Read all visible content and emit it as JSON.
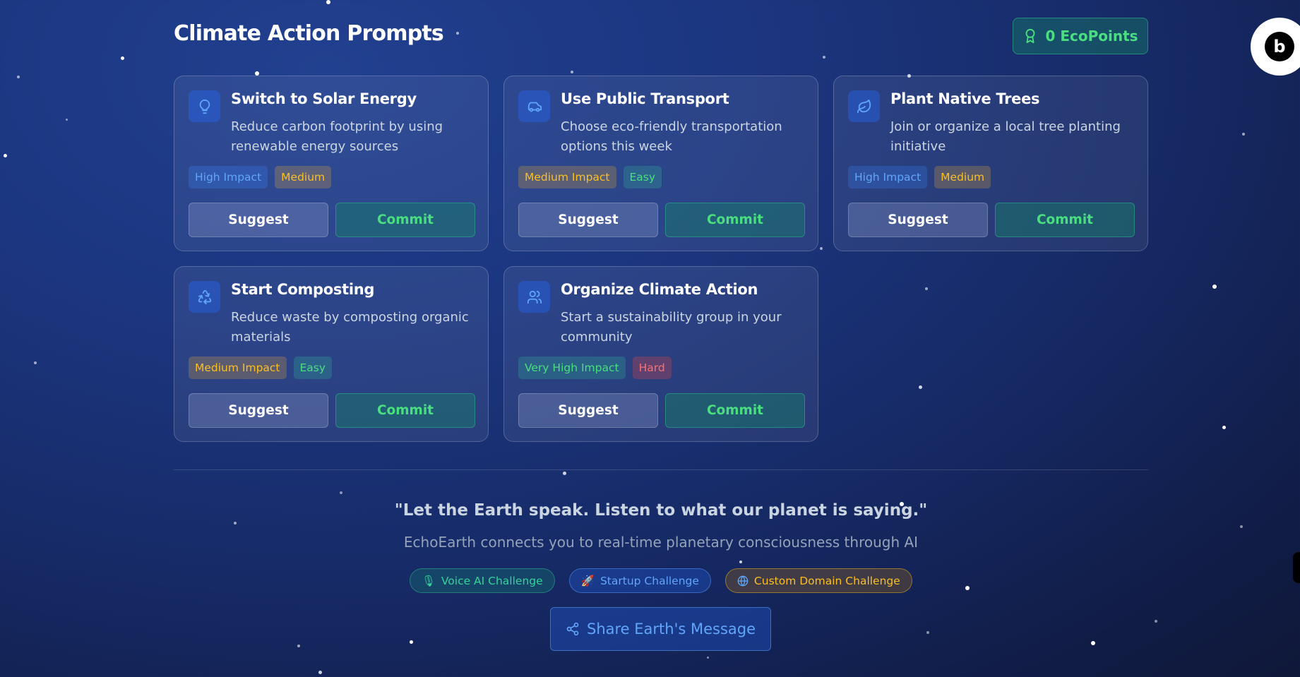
{
  "header": {
    "title": "Climate Action Prompts",
    "eco_points": "0 EcoPoints"
  },
  "actions": [
    {
      "title": "Switch to Solar Energy",
      "description": "Reduce carbon footprint by using renewable energy sources",
      "impact": "High Impact",
      "difficulty": "Medium",
      "icon": "lightbulb-icon",
      "suggest_label": "Suggest",
      "commit_label": "Commit"
    },
    {
      "title": "Use Public Transport",
      "description": "Choose eco-friendly transportation options this week",
      "impact": "Medium Impact",
      "difficulty": "Easy",
      "icon": "car-icon",
      "suggest_label": "Suggest",
      "commit_label": "Commit"
    },
    {
      "title": "Plant Native Trees",
      "description": "Join or organize a local tree planting initiative",
      "impact": "High Impact",
      "difficulty": "Medium",
      "icon": "leaf-icon",
      "suggest_label": "Suggest",
      "commit_label": "Commit"
    },
    {
      "title": "Start Composting",
      "description": "Reduce waste by composting organic materials",
      "impact": "Medium Impact",
      "difficulty": "Easy",
      "icon": "recycle-icon",
      "suggest_label": "Suggest",
      "commit_label": "Commit"
    },
    {
      "title": "Organize Climate Action",
      "description": "Start a sustainability group in your community",
      "impact": "Very High Impact",
      "difficulty": "Hard",
      "icon": "users-icon",
      "suggest_label": "Suggest",
      "commit_label": "Commit"
    }
  ],
  "footer": {
    "quote": "\"Let the Earth speak. Listen to what our planet is saying.\"",
    "tagline": "EchoEarth connects you to real-time planetary consciousness through AI",
    "challenges": [
      {
        "label": "Voice AI Challenge",
        "icon": "microphone-icon"
      },
      {
        "label": "Startup Challenge",
        "icon": "rocket-icon"
      },
      {
        "label": "Custom Domain Challenge",
        "icon": "globe-icon"
      }
    ],
    "share_label": "Share Earth's Message"
  },
  "badge": {
    "letter": "b"
  },
  "colors": {
    "accent_green": "#4ade80",
    "accent_blue": "#60a5fa",
    "accent_yellow": "#fbbf24",
    "accent_red": "#f87171"
  }
}
